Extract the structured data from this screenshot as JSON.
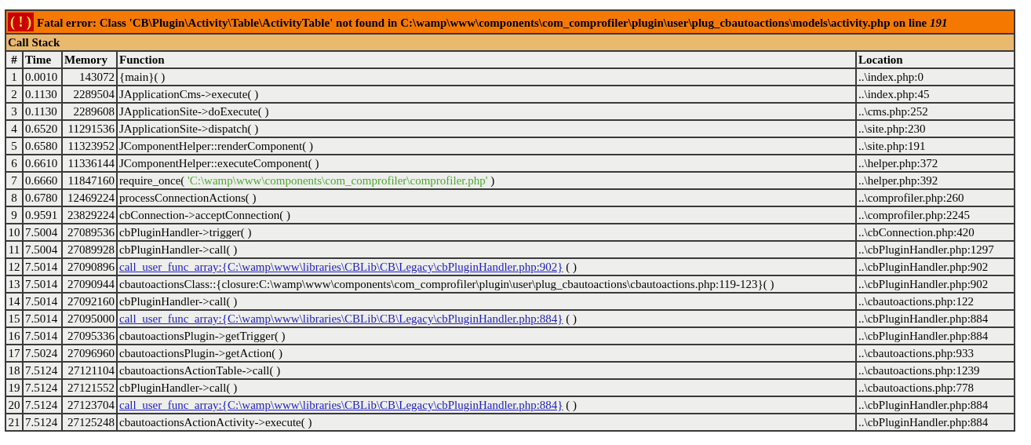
{
  "error": {
    "badge": "( ! )",
    "message": "Fatal error: Class 'CB\\Plugin\\Activity\\Table\\ActivityTable' not found in C:\\wamp\\www\\components\\com_comprofiler\\plugin\\user\\plug_cbautoactions\\models\\activity.php on line *191*"
  },
  "call_stack": {
    "title": "Call Stack",
    "columns": [
      "#",
      "Time",
      "Memory",
      "Function",
      "Location"
    ],
    "rows": [
      {
        "index": "1",
        "time": "0.0010",
        "memory": "143072",
        "kind": "call",
        "function": "{main}( )",
        "location": "..\\index.php:0"
      },
      {
        "index": "2",
        "time": "0.1130",
        "memory": "2289504",
        "kind": "call",
        "function": "JApplicationCms->execute( )",
        "location": "..\\index.php:45"
      },
      {
        "index": "3",
        "time": "0.1130",
        "memory": "2289608",
        "kind": "call",
        "function": "JApplicationSite->doExecute( )",
        "location": "..\\cms.php:252"
      },
      {
        "index": "4",
        "time": "0.6520",
        "memory": "11291536",
        "kind": "call",
        "function": "JApplicationSite->dispatch( )",
        "location": "..\\site.php:230"
      },
      {
        "index": "5",
        "time": "0.6580",
        "memory": "11323952",
        "kind": "call",
        "function": "JComponentHelper::renderComponent( )",
        "location": "..\\site.php:191"
      },
      {
        "index": "6",
        "time": "0.6610",
        "memory": "11336144",
        "kind": "call",
        "function": "JComponentHelper::executeComponent( )",
        "location": "..\\helper.php:372"
      },
      {
        "index": "7",
        "time": "0.6660",
        "memory": "11847160",
        "kind": "include",
        "function": "require_once(",
        "argument": "'C:\\wamp\\www\\components\\com_comprofiler\\comprofiler.php'",
        "closing": ")",
        "location": "..\\helper.php:392"
      },
      {
        "index": "8",
        "time": "0.6780",
        "memory": "12469224",
        "kind": "call",
        "function": "processConnectionActions( )",
        "location": "..\\comprofiler.php:260"
      },
      {
        "index": "9",
        "time": "0.9591",
        "memory": "23829224",
        "kind": "call",
        "function": "cbConnection->acceptConnection( )",
        "location": "..\\comprofiler.php:2245"
      },
      {
        "index": "10",
        "time": "7.5004",
        "memory": "27089536",
        "kind": "call",
        "function": "cbPluginHandler->trigger( )",
        "location": "..\\cbConnection.php:420"
      },
      {
        "index": "11",
        "time": "7.5004",
        "memory": "27089928",
        "kind": "call",
        "function": "cbPluginHandler->call( )",
        "location": "..\\cbPluginHandler.php:1297"
      },
      {
        "index": "12",
        "time": "7.5014",
        "memory": "27090896",
        "kind": "link",
        "function": "call_user_func_array:{C:\\wamp\\www\\libraries\\CBLib\\CB\\Legacy\\cbPluginHandler.php:902}",
        "suffix": "( )",
        "location": "..\\cbPluginHandler.php:902"
      },
      {
        "index": "13",
        "time": "7.5014",
        "memory": "27090944",
        "kind": "call",
        "function": "cbautoactionsClass::{closure:C:\\wamp\\www\\components\\com_comprofiler\\plugin\\user\\plug_cbautoactions\\cbautoactions.php:119-123}( )",
        "location": "..\\cbPluginHandler.php:902"
      },
      {
        "index": "14",
        "time": "7.5014",
        "memory": "27092160",
        "kind": "call",
        "function": "cbPluginHandler->call( )",
        "location": "..\\cbautoactions.php:122"
      },
      {
        "index": "15",
        "time": "7.5014",
        "memory": "27095000",
        "kind": "link",
        "function": "call_user_func_array:{C:\\wamp\\www\\libraries\\CBLib\\CB\\Legacy\\cbPluginHandler.php:884}",
        "suffix": "( )",
        "location": "..\\cbPluginHandler.php:884"
      },
      {
        "index": "16",
        "time": "7.5014",
        "memory": "27095336",
        "kind": "call",
        "function": "cbautoactionsPlugin->getTrigger( )",
        "location": "..\\cbPluginHandler.php:884"
      },
      {
        "index": "17",
        "time": "7.5024",
        "memory": "27096960",
        "kind": "call",
        "function": "cbautoactionsPlugin->getAction( )",
        "location": "..\\cbautoactions.php:933"
      },
      {
        "index": "18",
        "time": "7.5124",
        "memory": "27121104",
        "kind": "call",
        "function": "cbautoactionsActionTable->call( )",
        "location": "..\\cbautoactions.php:1239"
      },
      {
        "index": "19",
        "time": "7.5124",
        "memory": "27121552",
        "kind": "call",
        "function": "cbPluginHandler->call( )",
        "location": "..\\cbautoactions.php:778"
      },
      {
        "index": "20",
        "time": "7.5124",
        "memory": "27123704",
        "kind": "link",
        "function": "call_user_func_array:{C:\\wamp\\www\\libraries\\CBLib\\CB\\Legacy\\cbPluginHandler.php:884}",
        "suffix": "( )",
        "location": "..\\cbPluginHandler.php:884"
      },
      {
        "index": "21",
        "time": "7.5124",
        "memory": "27125248",
        "kind": "call",
        "function": "cbautoactionsActionActivity->execute( )",
        "location": "..\\cbPluginHandler.php:884"
      }
    ]
  }
}
